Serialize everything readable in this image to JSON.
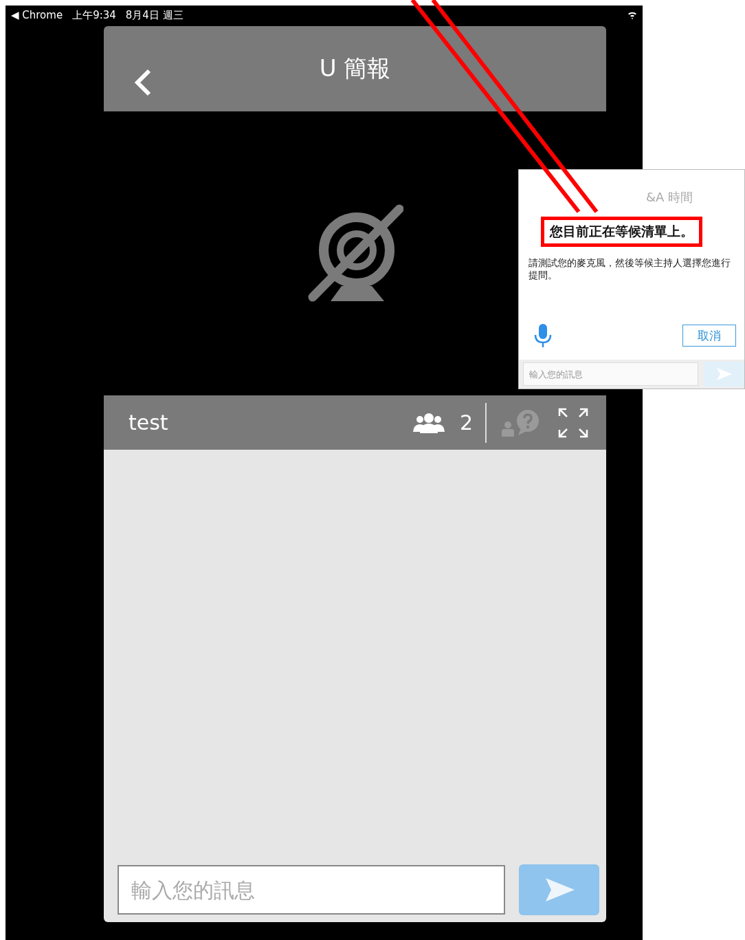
{
  "status_bar": {
    "back_app": "◀ Chrome",
    "time": "上午9:34",
    "date": "8月4日 週三"
  },
  "header": {
    "title": "U 簡報"
  },
  "chat": {
    "title": "test",
    "participants": "2",
    "input": {
      "placeholder": "輸入您的訊息"
    }
  },
  "qa_popup": {
    "title": "&A 時間",
    "heading": "您目前正在等候清單上。",
    "message": "請測試您的麥克風，然後等候主持人選擇您進行提問。",
    "cancel_button": "取消",
    "input": {
      "placeholder": "輸入您的訊息"
    }
  }
}
